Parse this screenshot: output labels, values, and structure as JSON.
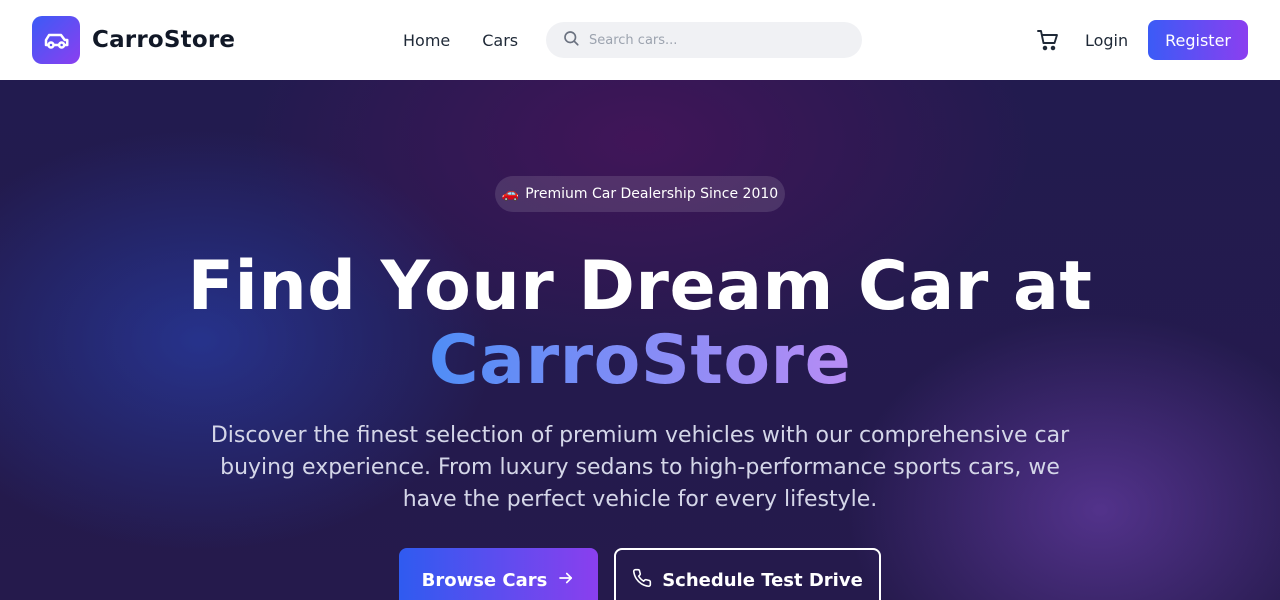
{
  "brand": {
    "name": "CarroStore",
    "logo_icon": "car-icon"
  },
  "nav": {
    "links": [
      {
        "label": "Home"
      },
      {
        "label": "Cars"
      }
    ],
    "search_placeholder": "Search cars...",
    "login_label": "Login",
    "register_label": "Register"
  },
  "hero": {
    "badge": "Premium Car Dealership Since 2010",
    "badge_emoji": "🚗",
    "headline_line1": "Find Your Dream Car at",
    "headline_line2": "CarroStore",
    "subtitle": "Discover the finest selection of premium vehicles with our comprehensive car buying experience. From luxury sedans to high-performance sports cars, we have the perfect vehicle for every lifestyle.",
    "primary_cta": "Browse Cars",
    "secondary_cta": "Schedule Test Drive"
  },
  "colors": {
    "accent_start": "#3b5bf6",
    "accent_end": "#8b3ff0",
    "hero_background": "#221b4f"
  }
}
